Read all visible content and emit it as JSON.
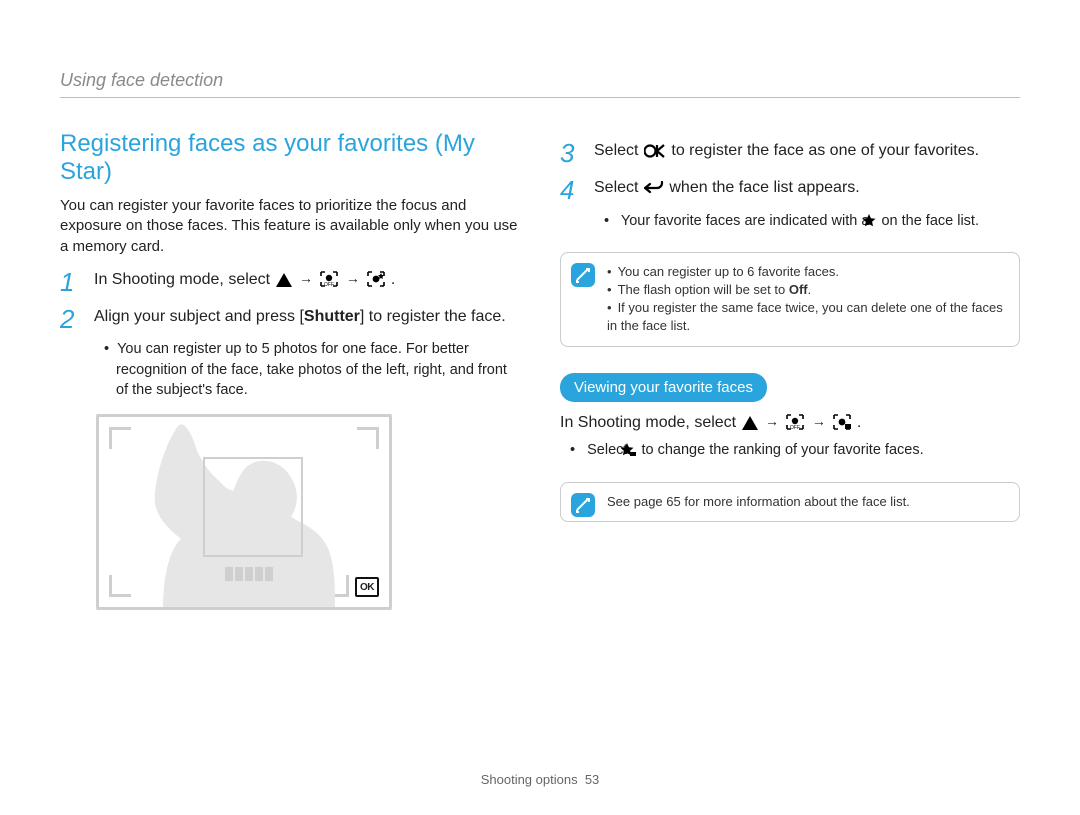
{
  "breadcrumb": "Using face detection",
  "title": "Registering faces as your favorites (My Star)",
  "intro": "You can register your favorite faces to prioritize the focus and exposure on those faces. This feature is available only when you use a memory card.",
  "step1": {
    "n": "1",
    "pre": "In Shooting mode, select ",
    "post": "."
  },
  "step2": {
    "n": "2",
    "pre": "Align your subject and press [",
    "bold": "Shutter",
    "post": "] to register the face."
  },
  "step2_bullet": "You can register up to 5 photos for one face. For better recognition of the face, take photos of the left, right, and front of the subject's face.",
  "step3": {
    "n": "3",
    "pre": "Select ",
    "post": " to register the face as one of your favorites."
  },
  "step4": {
    "n": "4",
    "pre": "Select ",
    "post": " when the face list appears."
  },
  "step4_bullet": {
    "pre": "Your favorite faces are indicated with a ",
    "post": " on the face list."
  },
  "note1": {
    "li1": "You can register up to 6 favorite faces.",
    "li2_pre": "The flash option will be set to ",
    "li2_bold": "Off",
    "li2_post": ".",
    "li3": "If you register the same face twice, you can delete one of the faces in the face list."
  },
  "pill": "Viewing your favorite faces",
  "viewing_line": {
    "pre": "In Shooting mode, select ",
    "post": "."
  },
  "viewing_bullet": {
    "pre": "Select ",
    "post": " to change the ranking of your favorite faces."
  },
  "note2": "See page 65 for more information about the face list.",
  "footer": {
    "section": "Shooting options",
    "page": "53"
  },
  "icons": {
    "ok_badge": "OK"
  }
}
